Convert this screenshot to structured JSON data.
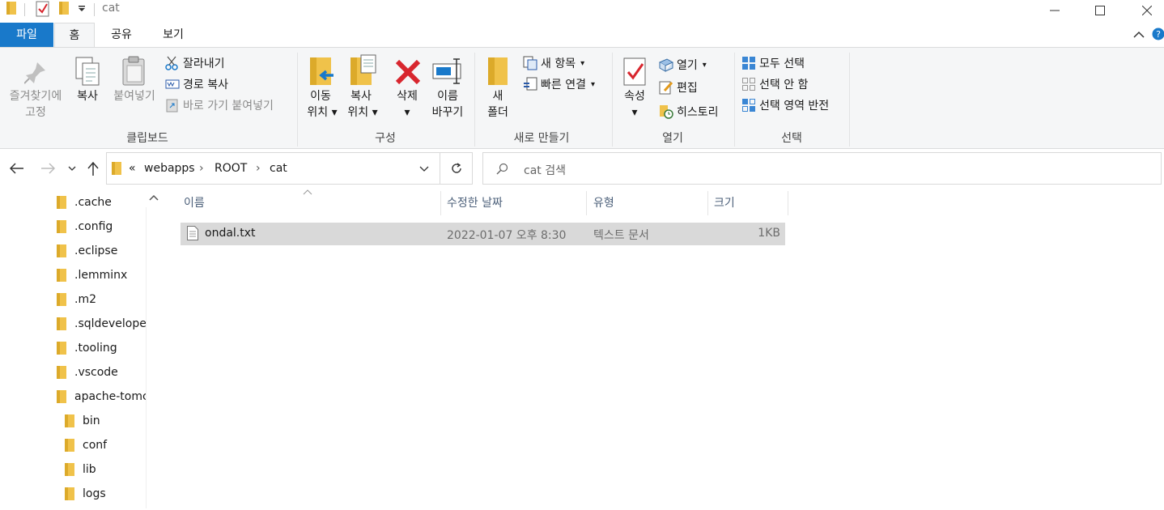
{
  "window": {
    "title": "cat"
  },
  "tabs": [
    "파일",
    "홈",
    "공유",
    "보기"
  ],
  "ribbon": {
    "clipboard": {
      "label": "클립보드",
      "pin_line1": "즐겨찾기에",
      "pin_line2": "고정",
      "copy": "복사",
      "paste": "붙여넣기",
      "cut": "잘라내기",
      "copy_path": "경로 복사",
      "paste_shortcut": "바로 가기 붙여넣기"
    },
    "organize": {
      "label": "구성",
      "move_line1": "이동",
      "move_line2": "위치",
      "copyto_line1": "복사",
      "copyto_line2": "위치",
      "delete_line1": "삭제",
      "rename_line1": "이름",
      "rename_line2": "바꾸기"
    },
    "new": {
      "label": "새로 만들기",
      "folder_line1": "새",
      "folder_line2": "폴더",
      "new_item": "새 항목",
      "easy_access": "빠른 연결"
    },
    "open": {
      "label": "열기",
      "properties": "속성",
      "open": "열기",
      "edit": "편집",
      "history": "히스토리"
    },
    "select": {
      "label": "선택",
      "select_all": "모두 선택",
      "select_none": "선택 안 함",
      "invert": "선택 영역 반전"
    }
  },
  "address": {
    "overflow": "«",
    "crumbs": [
      "webapps",
      "ROOT",
      "cat"
    ]
  },
  "search": {
    "placeholder": "cat 검색"
  },
  "nav_tree": [
    ".cache",
    ".config",
    ".eclipse",
    ".lemminx",
    ".m2",
    ".sqldeveloper",
    ".tooling",
    ".vscode",
    "apache-tomcat",
    "bin",
    "conf",
    "lib",
    "logs"
  ],
  "columns": {
    "name": "이름",
    "date": "수정한 날짜",
    "type": "유형",
    "size": "크기"
  },
  "files": [
    {
      "name": "ondal.txt",
      "date": "2022-01-07 오후 8:30",
      "type": "텍스트 문서",
      "size": "1KB"
    }
  ],
  "colors": {
    "file_tab": "#1979ca",
    "ribbon_bg": "#f5f6f7",
    "folder": "#f0c24a",
    "selected_row": "#d9d9d9",
    "delete_red": "#d8262e"
  }
}
